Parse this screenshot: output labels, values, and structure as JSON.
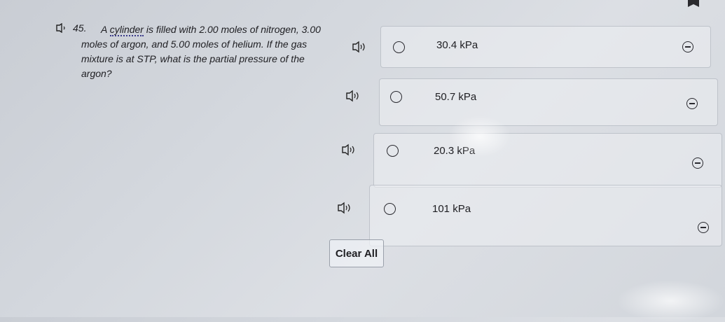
{
  "question": {
    "number": "45.",
    "text_before": "A ",
    "highlight": "cylinder",
    "text_after": " is filled with 2.00 moles of nitrogen, 3.00 moles of argon, and 5.00 moles of helium. If the gas mixture is at STP, what is the partial pressure of the argon?"
  },
  "answers": [
    {
      "label": "30.4 kPa"
    },
    {
      "label": "50.7 kPa"
    },
    {
      "label": "20.3 kPa"
    },
    {
      "label": "101 kPa"
    }
  ],
  "clear_button": "Clear All",
  "icons": {
    "speaker": "text-to-speech-icon",
    "eliminate": "eliminate-choice-icon",
    "bookmark": "bookmark-flag-icon"
  }
}
